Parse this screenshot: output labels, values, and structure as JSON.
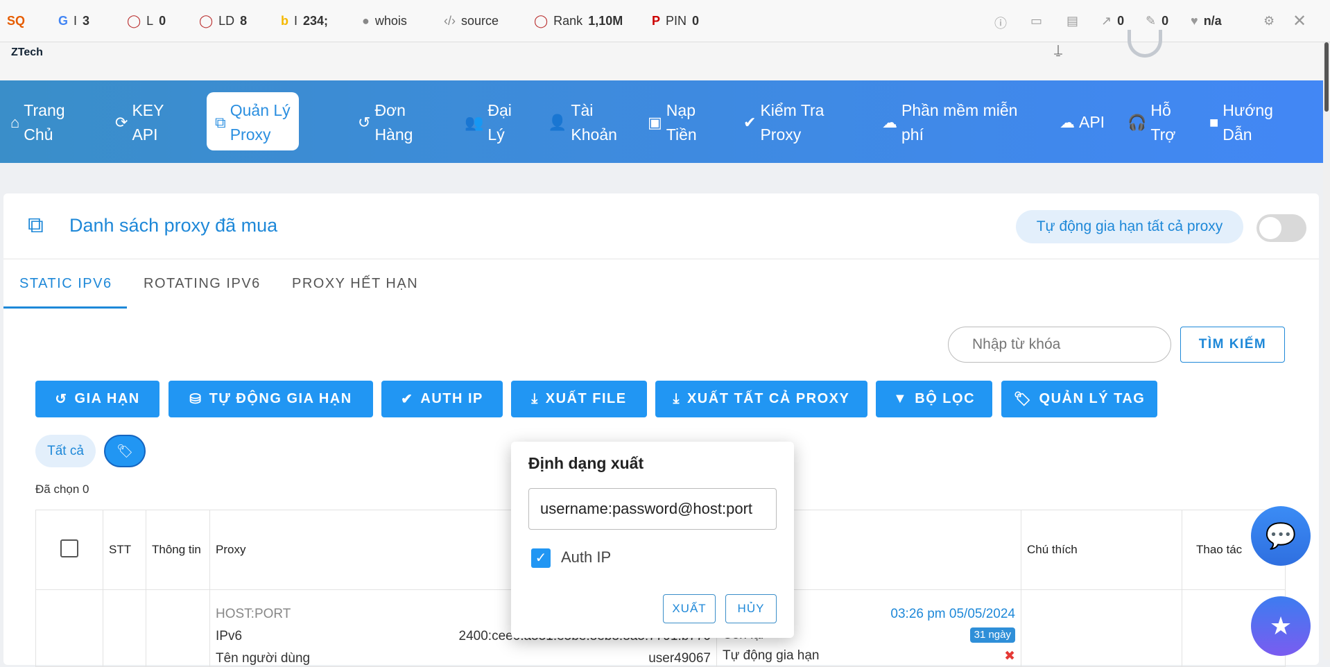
{
  "extension_bar": {
    "items": [
      {
        "icon": "seoquake-logo",
        "label": ""
      },
      {
        "icon": "google-icon",
        "label": "I",
        "value": "3"
      },
      {
        "icon": "circle-icon",
        "label": "L",
        "value": "0"
      },
      {
        "icon": "circle-icon",
        "label": "LD",
        "value": "8"
      },
      {
        "icon": "bing-icon",
        "label": "I",
        "value": "234;"
      },
      {
        "icon": "person-icon",
        "label": "whois",
        "value": ""
      },
      {
        "icon": "code-icon",
        "label": "source",
        "value": ""
      },
      {
        "icon": "circle-icon",
        "label": "Rank",
        "value": "1,10M"
      },
      {
        "icon": "pinterest-icon",
        "label": "PIN",
        "value": "0"
      }
    ],
    "right": {
      "external_links": "0",
      "internal_links": "0",
      "health": "n/a"
    }
  },
  "header": {
    "logo": "ZTech"
  },
  "nav": {
    "items": [
      {
        "label1": "Trang",
        "label2": "Chủ",
        "icon": "home-icon"
      },
      {
        "label1": "KEY",
        "label2": "API",
        "icon": "refresh-icon"
      },
      {
        "label1": "Quản Lý",
        "label2": "Proxy",
        "icon": "sitemap-icon",
        "active": true
      },
      {
        "label1": "Đơn",
        "label2": "Hàng",
        "icon": "history-icon"
      },
      {
        "label1": "Đại",
        "label2": "Lý",
        "icon": "users-icon"
      },
      {
        "label1": "Tài",
        "label2": "Khoản",
        "icon": "user-icon"
      },
      {
        "label1": "Nạp",
        "label2": "Tiền",
        "icon": "wallet-icon"
      },
      {
        "label1": "Kiểm Tra",
        "label2": "Proxy",
        "icon": "check-circle-icon"
      },
      {
        "label1": "Phần mềm miễn",
        "label2": "phí",
        "icon": "cloud-download-icon"
      },
      {
        "label1": "API",
        "label2": "",
        "icon": "cloud-icon"
      },
      {
        "label1": "Hỗ",
        "label2": "Trợ",
        "icon": "headset-icon"
      },
      {
        "label1": "Hướng",
        "label2": "Dẫn",
        "icon": "video-icon"
      }
    ]
  },
  "page": {
    "title": "Danh sách proxy đã mua",
    "auto_renew_all": "Tự động gia hạn tất cả proxy",
    "auto_renew_enabled": false
  },
  "tabs": [
    "STATIC IPV6",
    "ROTATING IPV6",
    "PROXY HẾT HẠN"
  ],
  "search": {
    "placeholder": "Nhập từ khóa",
    "button": "TÌM KIẾM"
  },
  "actions": [
    "GIA HẠN",
    "TỰ ĐỘNG GIA HẠN",
    "AUTH IP",
    "XUẤT FILE",
    "XUẤT TẤT CẢ PROXY",
    "BỘ LỌC",
    "QUẢN LÝ TAG"
  ],
  "filters": {
    "all": "Tất cả"
  },
  "selected": "Đã chọn 0",
  "table": {
    "headers": [
      "STT",
      "Thông tin",
      "Proxy",
      "",
      "Chú thích",
      "Thao tác"
    ],
    "row": {
      "host_port_label": "HOST:PORT",
      "ipv6_label": "IPv6",
      "ipv6_value": "2400:cee0:a551:e5be:8eb8:8a5:7791:b770",
      "user_label": "Tên người dùng",
      "user_value": "user49067",
      "date": "03:26 pm 05/05/2024",
      "remaining_label": "Còn lại",
      "remaining_badge": "31 ngày",
      "auto_renew_label": "Tự động gia hạn"
    }
  },
  "modal": {
    "title": "Định dạng xuất",
    "format_value": "username:password@host:port",
    "auth_ip_label": "Auth IP",
    "auth_ip_checked": true,
    "export_button": "XUẤT",
    "cancel_button": "HỦY"
  },
  "colors": {
    "primary": "#2196f3",
    "nav_start": "#3a8ec9",
    "nav_end": "#4287f5"
  }
}
